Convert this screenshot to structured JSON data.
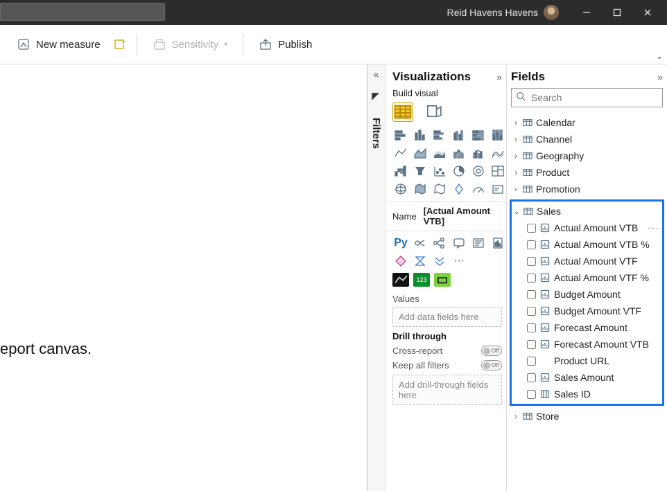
{
  "titlebar": {
    "username": "Reid Havens Havens"
  },
  "ribbon": {
    "new_measure": "New measure",
    "sensitivity": "Sensitivity",
    "publish": "Publish"
  },
  "canvas": {
    "hint": "eport canvas."
  },
  "filters_label": "Filters",
  "viz": {
    "title": "Visualizations",
    "subtitle": "Build visual",
    "name_label": "Name",
    "name_value": "[Actual Amount VTB]",
    "values_label": "Values",
    "values_placeholder": "Add data fields here",
    "drill_label": "Drill through",
    "cross_report": "Cross-report",
    "keep_all": "Keep all filters",
    "toggle_off": "Off",
    "drill_placeholder": "Add drill-through fields here",
    "py_label": "Py",
    "dots": "···",
    "store_badge": "123"
  },
  "fields": {
    "title": "Fields",
    "search_placeholder": "Search",
    "tables": {
      "calendar": "Calendar",
      "channel": "Channel",
      "geography": "Geography",
      "product": "Product",
      "promotion": "Promotion",
      "sales": "Sales",
      "store": "Store"
    },
    "sales_items": [
      {
        "label": "Actual Amount VTB",
        "icon": "measure",
        "more": true
      },
      {
        "label": "Actual Amount VTB %",
        "icon": "measure"
      },
      {
        "label": "Actual Amount VTF",
        "icon": "measure"
      },
      {
        "label": "Actual Amount VTF %",
        "icon": "measure"
      },
      {
        "label": "Budget Amount",
        "icon": "measure"
      },
      {
        "label": "Budget Amount VTF",
        "icon": "measure"
      },
      {
        "label": "Forecast Amount",
        "icon": "measure"
      },
      {
        "label": "Forecast Amount VTB",
        "icon": "measure"
      },
      {
        "label": "Product URL",
        "icon": "none"
      },
      {
        "label": "Sales Amount",
        "icon": "measure"
      },
      {
        "label": "Sales ID",
        "icon": "column"
      }
    ]
  }
}
